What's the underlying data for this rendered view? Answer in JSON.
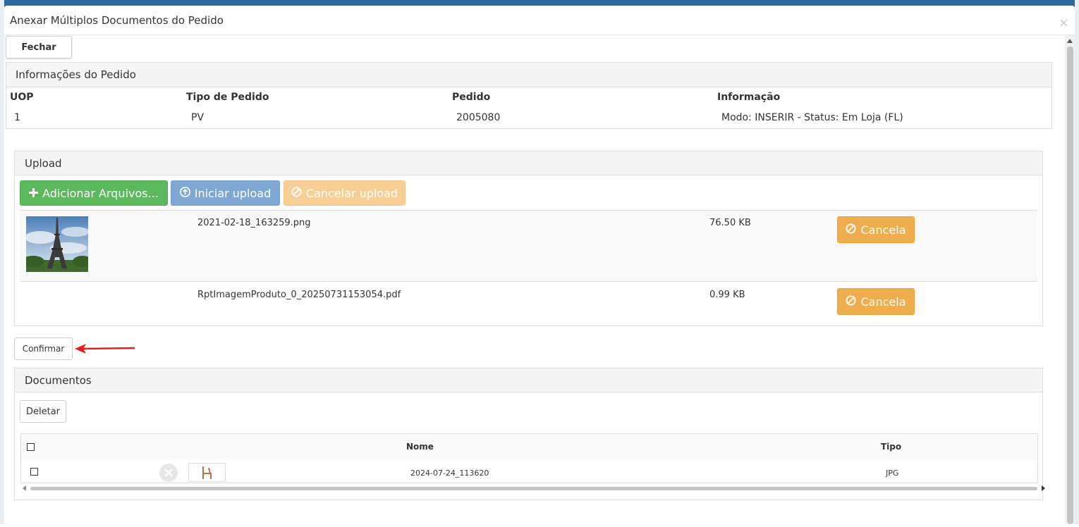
{
  "modal": {
    "title": "Anexar Múltiplos Documentos do Pedido",
    "close_glyph": "×",
    "close_button": "Fechar"
  },
  "order_info": {
    "heading": "Informações do Pedido",
    "columns": [
      {
        "label": "UOP",
        "value": "1"
      },
      {
        "label": "Tipo de Pedido",
        "value": "PV"
      },
      {
        "label": "Pedido",
        "value": "2005080"
      },
      {
        "label": "Informação",
        "value": "Modo: INSERIR - Status: Em Loja (FL)"
      }
    ]
  },
  "upload": {
    "heading": "Upload",
    "add_files": "Adicionar Arquivos...",
    "start_upload": "Iniciar upload",
    "cancel_upload": "Cancelar upload",
    "files": [
      {
        "name": "2021-02-18_163259.png",
        "size": "76.50 KB",
        "cancel": "Cancela",
        "thumbnail": "eiffel-tower-image"
      },
      {
        "name": "RptImagemProduto_0_20250731153054.pdf",
        "size": "0.99 KB",
        "cancel": "Cancela"
      }
    ]
  },
  "confirm_button": "Confirmar",
  "documents": {
    "heading": "Documentos",
    "delete_button": "Deletar",
    "columns": {
      "name": "Nome",
      "type": "Tipo"
    },
    "rows": [
      {
        "name": "2024-07-24_113620",
        "type": "JPG"
      }
    ]
  },
  "colors": {
    "success": "#5cb85c",
    "primary_disabled": "#7fa7d3",
    "warning": "#f0ad4e",
    "warning_disabled": "#f7ce94",
    "annotation_arrow": "#e02020"
  },
  "icons": {
    "plus": "plus-icon",
    "upload": "upload-circle-icon",
    "ban": "ban-icon",
    "remove": "remove-circle-icon",
    "chair": "chair-thumbnail-icon"
  }
}
